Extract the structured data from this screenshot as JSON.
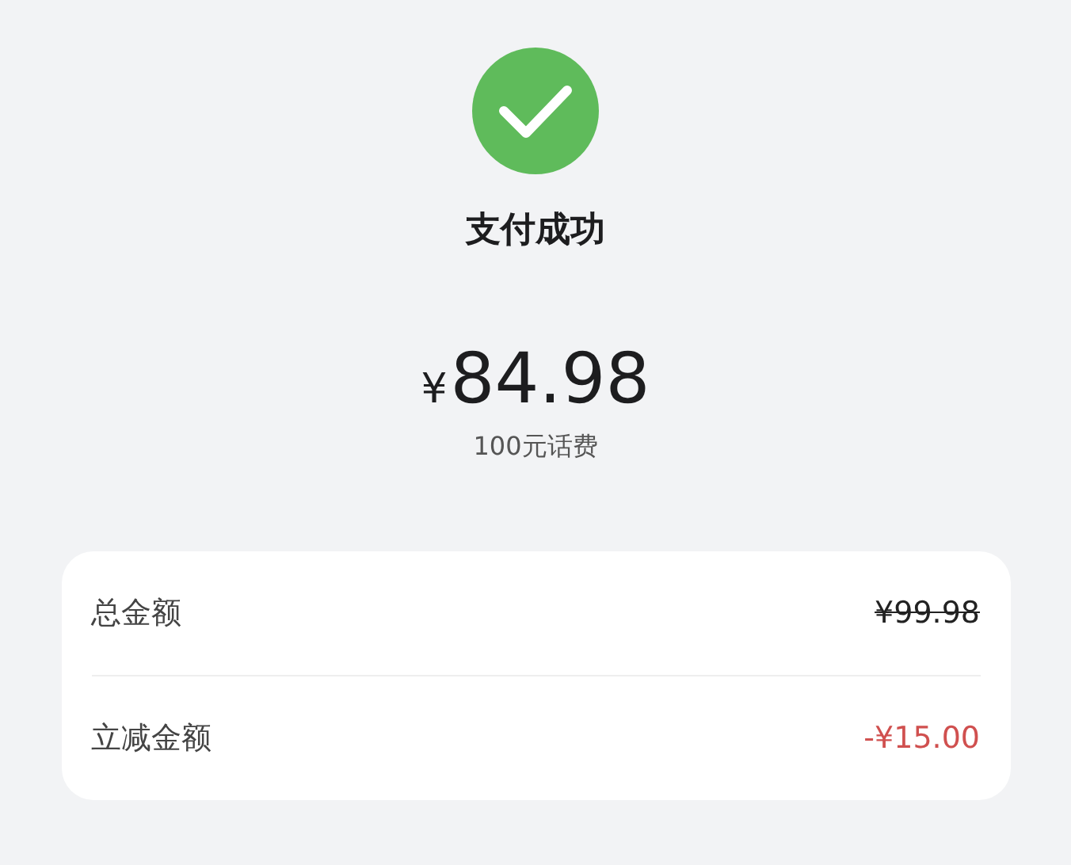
{
  "status": {
    "title": "支付成功"
  },
  "amount": {
    "currency": "¥",
    "value": "84.98",
    "description": "100元话费"
  },
  "details": [
    {
      "label": "总金额",
      "value": "¥99.98",
      "kind": "original"
    },
    {
      "label": "立减金额",
      "value": "-¥15.00",
      "kind": "discount"
    }
  ]
}
